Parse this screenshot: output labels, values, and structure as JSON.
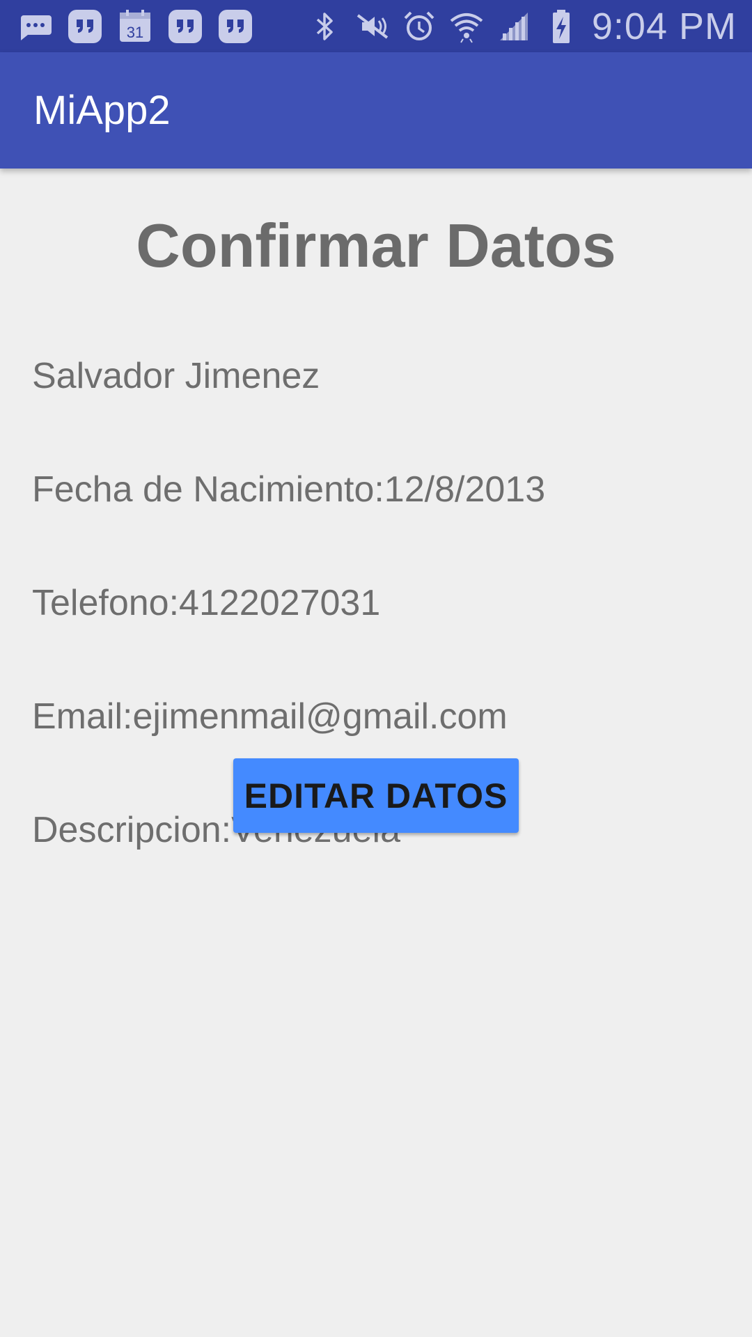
{
  "status_bar": {
    "time": "9:04 PM",
    "left_icons": [
      "message-icon",
      "hangouts-icon",
      "calendar-icon",
      "hangouts-icon",
      "hangouts-icon"
    ],
    "calendar_day": "31",
    "right_icons": [
      "bluetooth-icon",
      "mute-icon",
      "alarm-icon",
      "wifi-icon",
      "signal-icon",
      "battery-charging-icon"
    ],
    "color": "#303f9f"
  },
  "app_bar": {
    "title": "MiApp2",
    "color": "#3f51b5"
  },
  "main": {
    "heading": "Confirmar Datos",
    "name": "Salvador Jimenez",
    "birth_date": "Fecha de Nacimiento:12/8/2013",
    "phone": "Telefono:4122027031",
    "email": "Email:ejimenmail@gmail.com",
    "description": "Descripcion:Venezuela",
    "edit_button_label": "EDITAR DATOS",
    "accent": "#448aff"
  }
}
